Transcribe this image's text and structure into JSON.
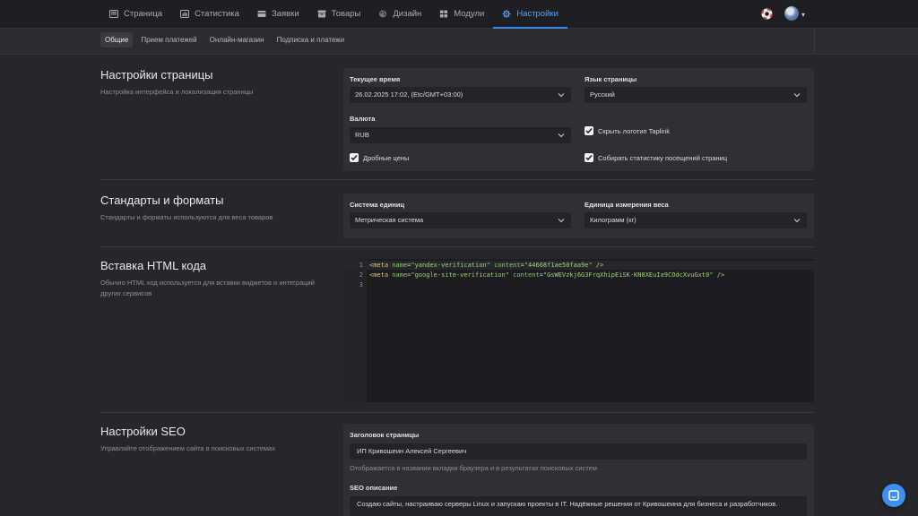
{
  "nav": {
    "items": [
      {
        "label": "Страница",
        "icon": "page-icon"
      },
      {
        "label": "Статистика",
        "icon": "stats-icon"
      },
      {
        "label": "Заявки",
        "icon": "requests-icon"
      },
      {
        "label": "Товары",
        "icon": "products-icon"
      },
      {
        "label": "Дизайн",
        "icon": "palette-icon"
      },
      {
        "label": "Модули",
        "icon": "modules-icon"
      },
      {
        "label": "Настройки",
        "icon": "settings-icon",
        "active": true
      }
    ]
  },
  "subnav": {
    "items": [
      "Общие",
      "Прием платежей",
      "Онлайн-магазин",
      "Подписка и платежи"
    ],
    "active": "Общие"
  },
  "page_settings": {
    "title": "Настройки страницы",
    "description": "Настройка интерфейса и локализация страницы",
    "current_time_label": "Текущее время",
    "current_time_value": "26.02.2025 17:02, (Etc/GMT+03:00)",
    "language_label": "Язык страницы",
    "language_value": "Русский",
    "currency_label": "Валюта",
    "currency_value": "RUB",
    "hide_logo_label": "Скрыть логотип Taplink",
    "hide_logo_checked": true,
    "fractional_prices_label": "Дробные цены",
    "fractional_prices_checked": true,
    "collect_stats_label": "Собирать статистику посещений страниц",
    "collect_stats_checked": true
  },
  "standards": {
    "title": "Стандарты и форматы",
    "description": "Стандарты и форматы используются для веса товаров",
    "units_label": "Система единиц",
    "units_value": "Метрическая система",
    "weight_label": "Единица измерения веса",
    "weight_value": "Килограмм (кг)"
  },
  "html_insert": {
    "title": "Вставка HTML кода",
    "description": "Обычно HTML код используется для вставки виджетов и интеграций других сервисов",
    "lines": [
      {
        "num": "1",
        "tag_open": "<meta",
        "a1": "name",
        "v1": "\"yandex-verification\"",
        "a2": "content",
        "v2": "\"44668f1ae50faa9e\"",
        "tag_close": "/>"
      },
      {
        "num": "2",
        "tag_open": "<meta",
        "a1": "name",
        "v1": "\"google-site-verification\"",
        "a2": "content",
        "v2": "\"GsWEVzkj6G3FrqXhipEiSK-KN8XEuIa9COdcXvuGxt0\"",
        "tag_close": "/>"
      },
      {
        "num": "3"
      }
    ]
  },
  "seo": {
    "title": "Настройки SEO",
    "description": "Управляйте отображением сайта в поисковых системах",
    "page_title_label": "Заголовок страницы",
    "page_title_value": "ИП Кривошеин Алексей Сергеевич",
    "page_title_hint": "Отображается в названии вкладки браузера и в результатах поисковых систем",
    "seo_desc_label": "SEO описание",
    "seo_desc_value": "Создаю сайты, настраиваю серверы Linux и запускаю проекты в IT. Надёжные решения от Кривошеина для бизнеса и разработчиков."
  },
  "colors": {
    "accent": "#3d8be8",
    "background": "#26272b",
    "panel": "#2f3034"
  }
}
